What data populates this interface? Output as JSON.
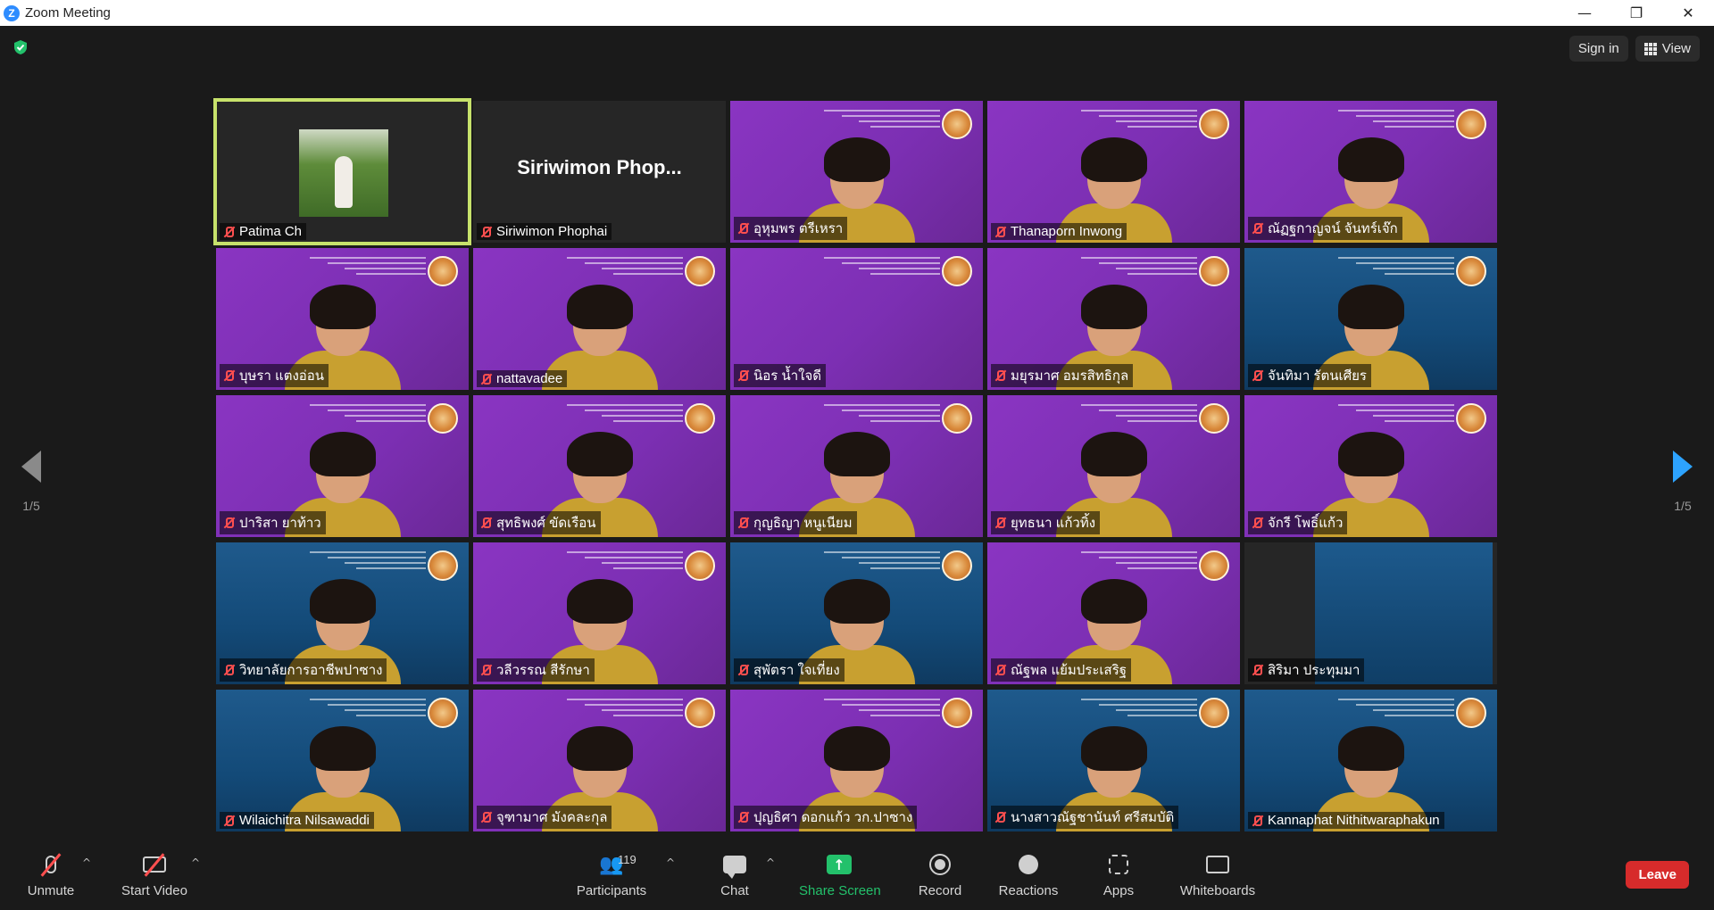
{
  "window": {
    "title": "Zoom Meeting",
    "logo": "Z",
    "minimize": "—",
    "restore": "❐",
    "close": "✕"
  },
  "top": {
    "signin": "Sign in",
    "view": "View"
  },
  "pager": {
    "left": "1/5",
    "right": "1/5"
  },
  "tiles": [
    {
      "name": "Patima Ch",
      "style": "dark",
      "active": true,
      "photo": true
    },
    {
      "name": "Siriwimon Phophai",
      "style": "dark",
      "big": "Siriwimon  Phop..."
    },
    {
      "name": "อุหุมพร ตรีเหรา",
      "style": "purple",
      "person": true
    },
    {
      "name": "Thanaporn Inwong",
      "style": "purple",
      "person": true
    },
    {
      "name": "ณัฏฐกาญจน์ จันทร์เจ๊ก",
      "style": "purple",
      "person": true
    },
    {
      "name": "บุษรา แตงอ่อน",
      "style": "purple",
      "person": true
    },
    {
      "name": "nattavadee",
      "style": "purple",
      "person": true
    },
    {
      "name": "นิอร น้ำใจดี",
      "style": "purple",
      "person": false
    },
    {
      "name": "มยุรมาศ อมรสิทธิกุล",
      "style": "purple",
      "person": true
    },
    {
      "name": "จันทิมา รัตนเศียร",
      "style": "blue",
      "person": true
    },
    {
      "name": "ปาริสา ยาท้าว",
      "style": "purple",
      "person": true
    },
    {
      "name": "สุทธิพงศ์ ขัดเรือน",
      "style": "purple",
      "person": true
    },
    {
      "name": "กุญธิญา หนูเนียม",
      "style": "purple",
      "person": true
    },
    {
      "name": "ยุทธนา แก้วทิ้ง",
      "style": "purple",
      "person": true
    },
    {
      "name": "จักรี โพธิ์แก้ว",
      "style": "purple",
      "person": true
    },
    {
      "name": "วิทยาลัยการอาชีพปาซาง",
      "style": "blue",
      "person": true
    },
    {
      "name": "วลีวรรณ สีรักษา",
      "style": "purple",
      "person": true
    },
    {
      "name": "สุพัตรา ใจเที่ยง",
      "style": "blue",
      "person": true
    },
    {
      "name": "ณัฐพล แย้มประเสริฐ",
      "style": "purple",
      "person": true
    },
    {
      "name": "สิริมา ประทุมมา",
      "style": "dark",
      "videobox": true
    },
    {
      "name": "Wilaichitra Nilsawaddi",
      "style": "blue",
      "person": true
    },
    {
      "name": "จุฑามาศ มังคละกุล",
      "style": "purple",
      "person": true
    },
    {
      "name": "ปุญธิศา ดอกแก้ว วก.ปาซาง",
      "style": "purple",
      "person": true
    },
    {
      "name": "นางสาวณัฐชานันท์ ศรีสมบัติ",
      "style": "blue",
      "person": true
    },
    {
      "name": "Kannaphat Nithitwaraphakun",
      "style": "blue",
      "person": true
    }
  ],
  "toolbar": {
    "unmute": "Unmute",
    "start_video": "Start Video",
    "participants": "Participants",
    "participant_count": "119",
    "chat": "Chat",
    "share": "Share Screen",
    "record": "Record",
    "reactions": "Reactions",
    "apps": "Apps",
    "whiteboards": "Whiteboards",
    "leave": "Leave",
    "caret": "^"
  }
}
